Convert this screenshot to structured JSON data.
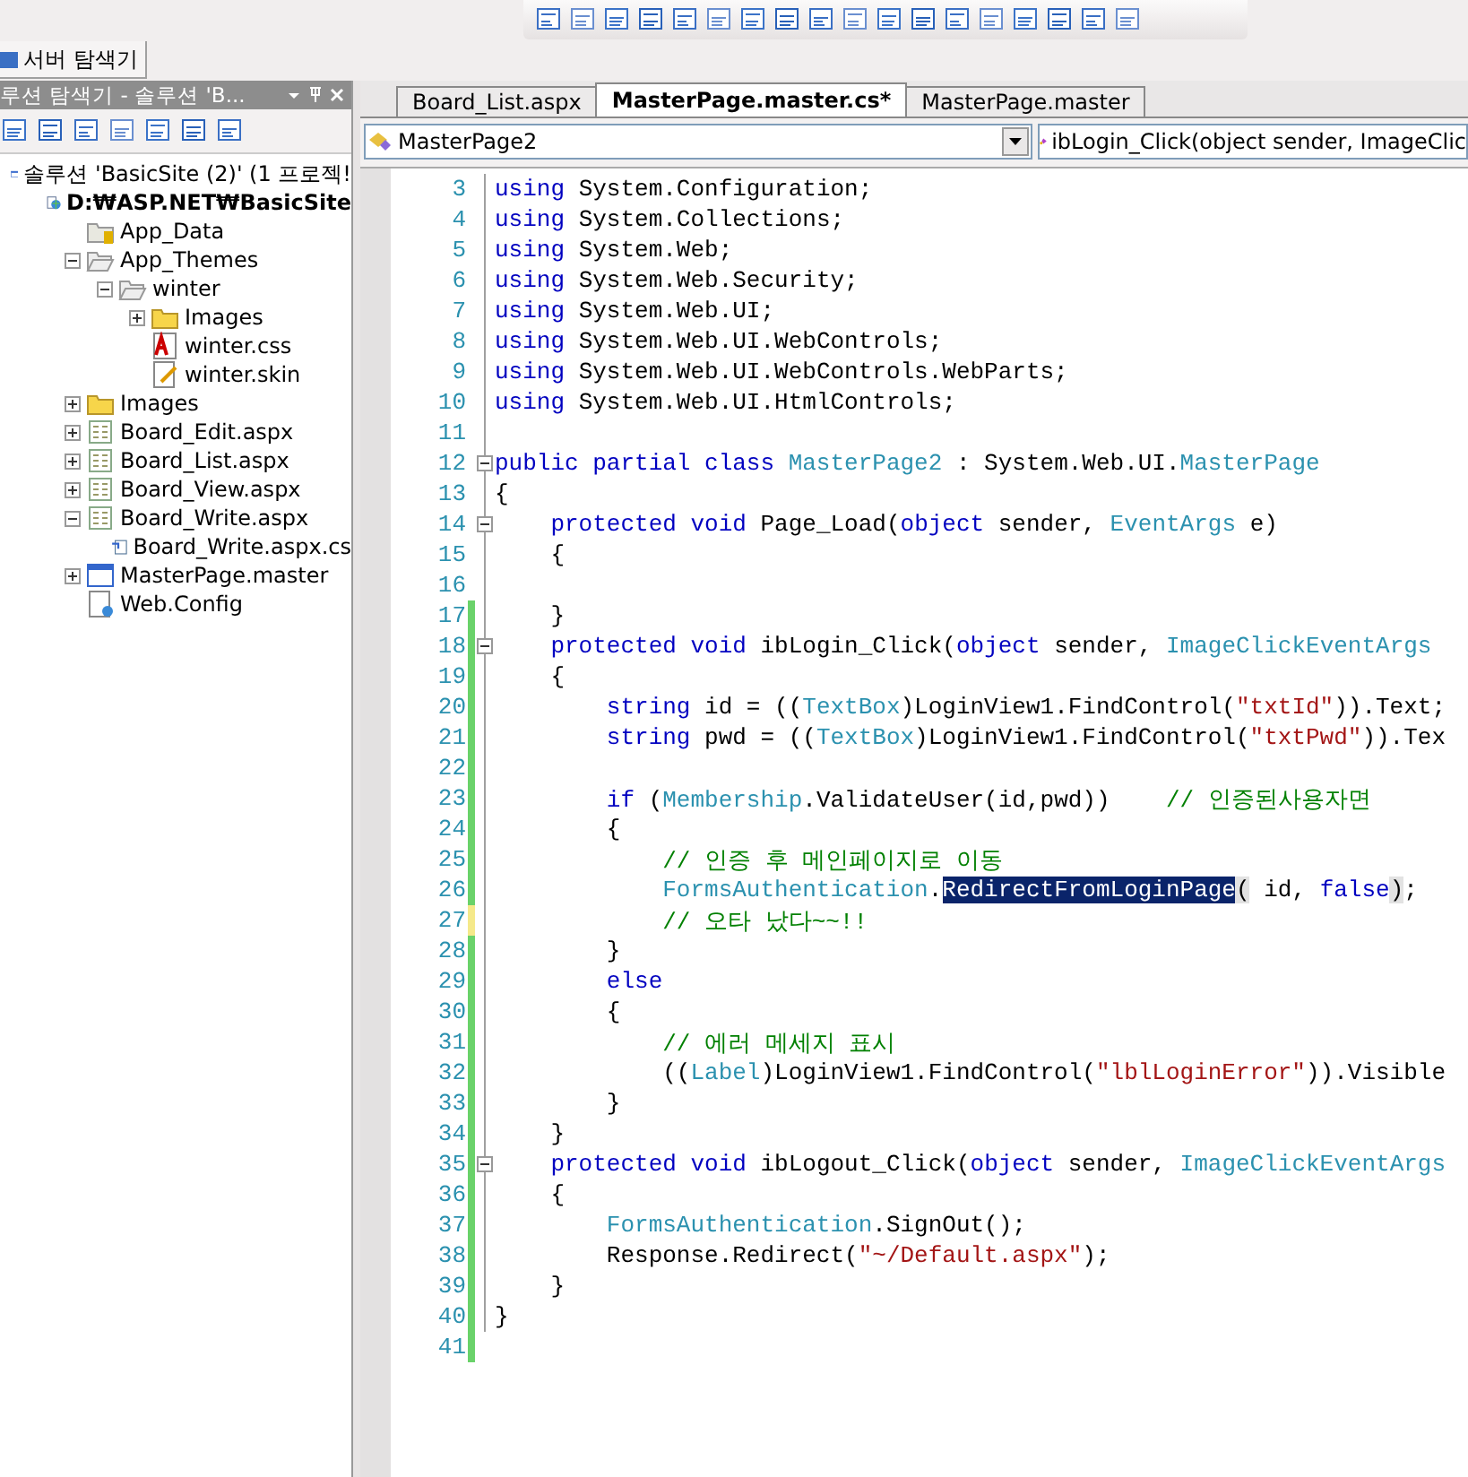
{
  "server_explorer_tab": {
    "label": "서버 탐색기"
  },
  "solution_explorer": {
    "title": "루션 탐색기 - 솔루션 'B...",
    "tree": [
      {
        "label": "솔루션 'BasicSite (2)' (1 프로젝!",
        "kind": "solution",
        "children": [
          {
            "label": "D:₩ASP.NET₩BasicSite",
            "kind": "project",
            "children": [
              {
                "label": "App_Data",
                "kind": "datafolder"
              },
              {
                "label": "App_Themes",
                "kind": "openfolder",
                "expanded": true,
                "children": [
                  {
                    "label": "winter",
                    "kind": "openfolder",
                    "expanded": true,
                    "children": [
                      {
                        "label": "Images",
                        "kind": "folder",
                        "expanded": false
                      },
                      {
                        "label": "winter.css",
                        "kind": "css"
                      },
                      {
                        "label": "winter.skin",
                        "kind": "skin"
                      }
                    ]
                  }
                ]
              },
              {
                "label": "Images",
                "kind": "folder",
                "expanded": false
              },
              {
                "label": "Board_Edit.aspx",
                "kind": "page",
                "expanded": false
              },
              {
                "label": "Board_List.aspx",
                "kind": "page",
                "expanded": false
              },
              {
                "label": "Board_View.aspx",
                "kind": "page",
                "expanded": false
              },
              {
                "label": "Board_Write.aspx",
                "kind": "page",
                "expanded": true,
                "children": [
                  {
                    "label": "Board_Write.aspx.cs",
                    "kind": "code"
                  }
                ]
              },
              {
                "label": "MasterPage.master",
                "kind": "master",
                "expanded": false
              },
              {
                "label": "Web.Config",
                "kind": "config"
              }
            ]
          }
        ]
      }
    ]
  },
  "editor": {
    "tabs": [
      {
        "label": "Board_List.aspx",
        "selected": false
      },
      {
        "label": "MasterPage.master.cs*",
        "selected": true
      },
      {
        "label": "MasterPage.master",
        "selected": false
      }
    ],
    "class_combo": "MasterPage2",
    "member_combo": "ibLogin_Click(object sender, ImageClic",
    "lines": [
      {
        "n": "3",
        "code": [
          {
            "kind": "kw",
            "text": "using"
          },
          {
            "kind": "plain",
            "text": " System.Configuration;"
          }
        ]
      },
      {
        "n": "4",
        "code": [
          {
            "kind": "kw",
            "text": "using"
          },
          {
            "kind": "plain",
            "text": " System.Collections;"
          }
        ]
      },
      {
        "n": "5",
        "code": [
          {
            "kind": "kw",
            "text": "using"
          },
          {
            "kind": "plain",
            "text": " System.Web;"
          }
        ]
      },
      {
        "n": "6",
        "code": [
          {
            "kind": "kw",
            "text": "using"
          },
          {
            "kind": "plain",
            "text": " System.Web.Security;"
          }
        ]
      },
      {
        "n": "7",
        "code": [
          {
            "kind": "kw",
            "text": "using"
          },
          {
            "kind": "plain",
            "text": " System.Web.UI;"
          }
        ]
      },
      {
        "n": "8",
        "code": [
          {
            "kind": "kw",
            "text": "using"
          },
          {
            "kind": "plain",
            "text": " System.Web.UI.WebControls;"
          }
        ]
      },
      {
        "n": "9",
        "code": [
          {
            "kind": "kw",
            "text": "using"
          },
          {
            "kind": "plain",
            "text": " System.Web.UI.WebControls.WebParts;"
          }
        ]
      },
      {
        "n": "10",
        "code": [
          {
            "kind": "kw",
            "text": "using"
          },
          {
            "kind": "plain",
            "text": " System.Web.UI.HtmlControls;"
          }
        ]
      },
      {
        "n": "11"
      },
      {
        "n": "12",
        "collapsible": true,
        "code": [
          {
            "kind": "kw",
            "text": "public partial class"
          },
          {
            "kind": "type",
            "text": " MasterPage2"
          },
          {
            "kind": "plain",
            "text": " : System.Web.UI."
          },
          {
            "kind": "type",
            "text": "MasterPage"
          }
        ]
      },
      {
        "n": "13",
        "code": [
          {
            "kind": "plain",
            "text": "{"
          }
        ]
      },
      {
        "n": "14",
        "collapsible": true,
        "code": [
          {
            "kind": "kw",
            "text": "    protected void"
          },
          {
            "kind": "plain",
            "text": " Page_Load("
          },
          {
            "kind": "kw",
            "text": "object"
          },
          {
            "kind": "plain",
            "text": " sender, "
          },
          {
            "kind": "type",
            "text": "EventArgs"
          },
          {
            "kind": "plain",
            "text": " e)"
          }
        ]
      },
      {
        "n": "15",
        "code": [
          {
            "kind": "plain",
            "text": "    {"
          }
        ]
      },
      {
        "n": "16"
      },
      {
        "n": "17",
        "color": "#6ad26a",
        "code": [
          {
            "kind": "plain",
            "text": "    }"
          }
        ]
      },
      {
        "n": "18",
        "collapsible": true,
        "color": "#6ad26a",
        "code": [
          {
            "kind": "kw",
            "text": "    protected void"
          },
          {
            "kind": "plain",
            "text": " ibLogin_Click("
          },
          {
            "kind": "kw",
            "text": "object"
          },
          {
            "kind": "plain",
            "text": " sender, "
          },
          {
            "kind": "type",
            "text": "ImageClickEventArgs"
          }
        ]
      },
      {
        "n": "19",
        "color": "#6ad26a",
        "code": [
          {
            "kind": "plain",
            "text": "    {"
          }
        ]
      },
      {
        "n": "20",
        "color": "#6ad26a",
        "code": [
          {
            "kind": "kw",
            "text": "        string"
          },
          {
            "kind": "plain",
            "text": " id = (("
          },
          {
            "kind": "type",
            "text": "TextBox"
          },
          {
            "kind": "plain",
            "text": ")LoginView1.FindControl("
          },
          {
            "kind": "str",
            "text": "\"txtId\""
          },
          {
            "kind": "plain",
            "text": ")).Text;"
          }
        ]
      },
      {
        "n": "21",
        "color": "#6ad26a",
        "code": [
          {
            "kind": "kw",
            "text": "        string"
          },
          {
            "kind": "plain",
            "text": " pwd = (("
          },
          {
            "kind": "type",
            "text": "TextBox"
          },
          {
            "kind": "plain",
            "text": ")LoginView1.FindControl("
          },
          {
            "kind": "str",
            "text": "\"txtPwd\""
          },
          {
            "kind": "plain",
            "text": ")).Tex"
          }
        ]
      },
      {
        "n": "22",
        "color": "#6ad26a"
      },
      {
        "n": "23",
        "color": "#6ad26a",
        "code": [
          {
            "kind": "kw",
            "text": "        if"
          },
          {
            "kind": "plain",
            "text": " ("
          },
          {
            "kind": "type",
            "text": "Membership"
          },
          {
            "kind": "plain",
            "text": ".ValidateUser(id,pwd))    "
          },
          {
            "kind": "cmt",
            "text": "// 인증된사용자면"
          }
        ]
      },
      {
        "n": "24",
        "color": "#6ad26a",
        "code": [
          {
            "kind": "plain",
            "text": "        {"
          }
        ]
      },
      {
        "n": "25",
        "color": "#6ad26a",
        "code": [
          {
            "kind": "cmt",
            "text": "            // 인증 후 메인페이지로 이동"
          }
        ]
      },
      {
        "n": "26",
        "color": "#6ad26a",
        "code": [
          {
            "kind": "type",
            "text": "            FormsAuthentication"
          },
          {
            "kind": "plain",
            "text": "."
          },
          {
            "kind": "sel",
            "text": "RedirectFromLoginPage"
          },
          {
            "kind": "match",
            "text": "("
          },
          {
            "kind": "plain",
            "text": " id, "
          },
          {
            "kind": "kw",
            "text": "false"
          },
          {
            "kind": "match",
            "text": ")"
          },
          {
            "kind": "plain",
            "text": ";"
          }
        ]
      },
      {
        "n": "27",
        "color": "#f5e98a",
        "code": [
          {
            "kind": "cmt",
            "text": "            // 오타 났다~~!!"
          }
        ]
      },
      {
        "n": "28",
        "color": "#6ad26a",
        "code": [
          {
            "kind": "plain",
            "text": "        }"
          }
        ]
      },
      {
        "n": "29",
        "color": "#6ad26a",
        "code": [
          {
            "kind": "kw",
            "text": "        else"
          }
        ]
      },
      {
        "n": "30",
        "color": "#6ad26a",
        "code": [
          {
            "kind": "plain",
            "text": "        {"
          }
        ]
      },
      {
        "n": "31",
        "color": "#6ad26a",
        "code": [
          {
            "kind": "cmt",
            "text": "            // 에러 메세지 표시"
          }
        ]
      },
      {
        "n": "32",
        "color": "#6ad26a",
        "code": [
          {
            "kind": "plain",
            "text": "            (("
          },
          {
            "kind": "type",
            "text": "Label"
          },
          {
            "kind": "plain",
            "text": ")LoginView1.FindControl("
          },
          {
            "kind": "str",
            "text": "\"lblLoginError\""
          },
          {
            "kind": "plain",
            "text": ")).Visible"
          }
        ]
      },
      {
        "n": "33",
        "color": "#6ad26a",
        "code": [
          {
            "kind": "plain",
            "text": "        }"
          }
        ]
      },
      {
        "n": "34",
        "color": "#6ad26a",
        "code": [
          {
            "kind": "plain",
            "text": "    }"
          }
        ]
      },
      {
        "n": "35",
        "collapsible": true,
        "color": "#6ad26a",
        "code": [
          {
            "kind": "kw",
            "text": "    protected void"
          },
          {
            "kind": "plain",
            "text": " ibLogout_Click("
          },
          {
            "kind": "kw",
            "text": "object"
          },
          {
            "kind": "plain",
            "text": " sender, "
          },
          {
            "kind": "type",
            "text": "ImageClickEventArgs"
          }
        ]
      },
      {
        "n": "36",
        "color": "#6ad26a",
        "code": [
          {
            "kind": "plain",
            "text": "    {"
          }
        ]
      },
      {
        "n": "37",
        "color": "#6ad26a",
        "code": [
          {
            "kind": "type",
            "text": "        FormsAuthentication"
          },
          {
            "kind": "plain",
            "text": ".SignOut();"
          }
        ]
      },
      {
        "n": "38",
        "color": "#6ad26a",
        "code": [
          {
            "kind": "plain",
            "text": "        Response.Redirect("
          },
          {
            "kind": "str",
            "text": "\"~/Default.aspx\""
          },
          {
            "kind": "plain",
            "text": ");"
          }
        ]
      },
      {
        "n": "39",
        "color": "#6ad26a",
        "code": [
          {
            "kind": "plain",
            "text": "    }"
          }
        ]
      },
      {
        "n": "40",
        "color": "#6ad26a",
        "code": [
          {
            "kind": "plain",
            "text": "}"
          }
        ]
      },
      {
        "n": "41",
        "color": "#6ad26a"
      }
    ]
  }
}
